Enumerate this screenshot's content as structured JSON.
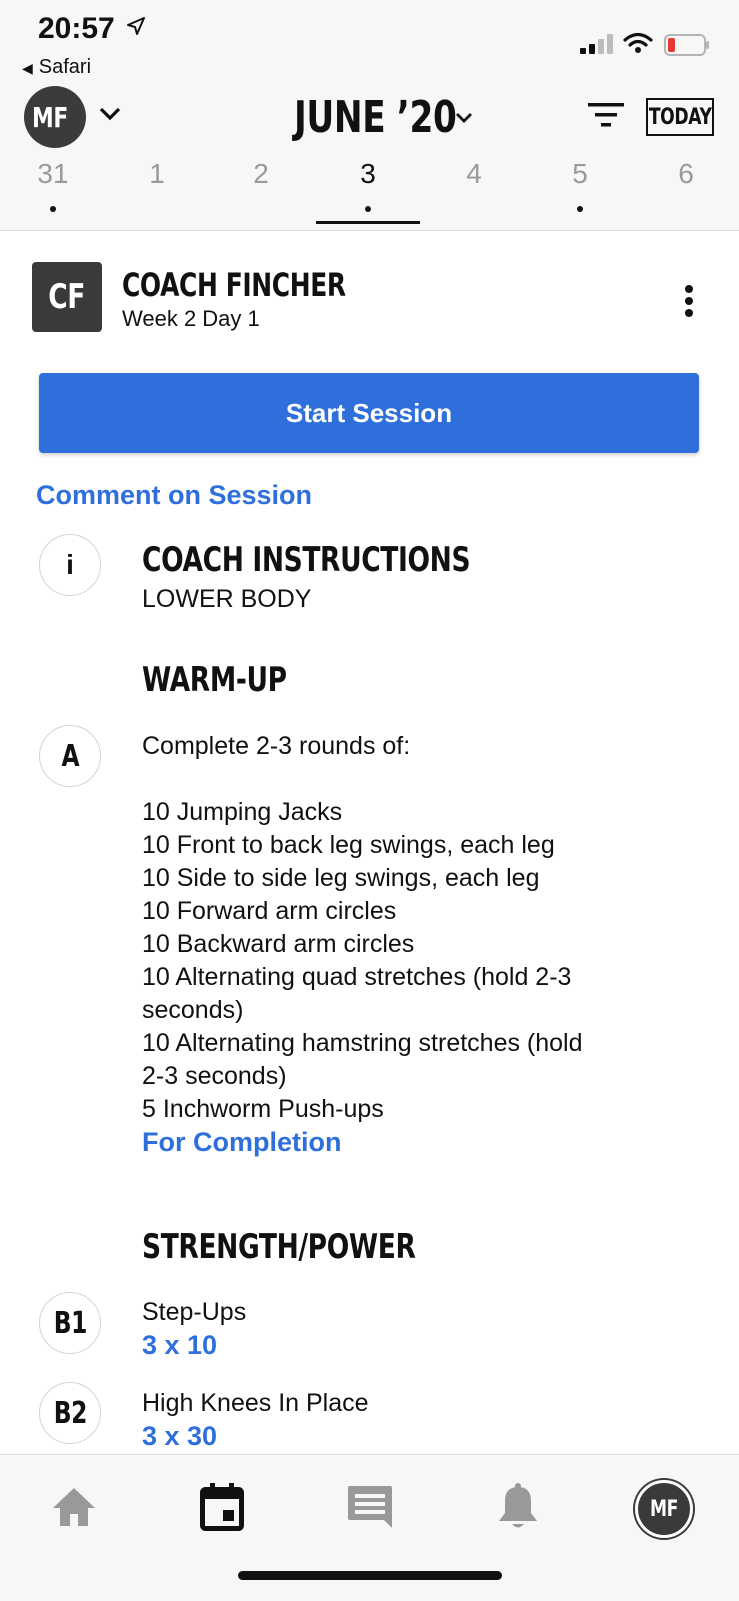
{
  "status_bar": {
    "time": "20:57",
    "back_app": "Safari",
    "location_icon": "location-arrow-icon",
    "signal_icon": "cellular-signal-icon",
    "wifi_icon": "wifi-icon",
    "battery_icon": "battery-low-icon",
    "battery_color": "#e53935"
  },
  "header": {
    "avatar_initials": "MF",
    "month_label": "JUNE ’20",
    "today_label": "TODAY",
    "filter_icon": "filter-icon",
    "days": [
      {
        "label": "31",
        "has_event": true,
        "selected": false
      },
      {
        "label": "1",
        "has_event": false,
        "selected": false
      },
      {
        "label": "2",
        "has_event": false,
        "selected": false
      },
      {
        "label": "3",
        "has_event": true,
        "selected": true
      },
      {
        "label": "4",
        "has_event": false,
        "selected": false
      },
      {
        "label": "5",
        "has_event": true,
        "selected": false
      },
      {
        "label": "6",
        "has_event": false,
        "selected": false
      }
    ]
  },
  "coach": {
    "logo_initials": "CF",
    "name": "COACH FINCHER",
    "subtitle": "Week 2 Day 1"
  },
  "actions": {
    "start_session": "Start Session",
    "comment": "Comment on Session"
  },
  "instructions": {
    "badge": "i",
    "title": "COACH INSTRUCTIONS",
    "text": "LOWER BODY"
  },
  "warmup": {
    "title": "WARM-UP",
    "badge": "A",
    "intro": "Complete 2-3 rounds of:",
    "lines": [
      "10 Jumping Jacks",
      "10 Front to back leg swings, each leg",
      "10 Side to side leg swings, each leg",
      "10 Forward arm circles",
      "10 Backward arm circles",
      "10 Alternating quad stretches (hold 2-3",
      "seconds)",
      "10 Alternating hamstring stretches (hold",
      "2-3 seconds)",
      "5 Inchworm Push-ups"
    ],
    "completion": "For Completion"
  },
  "strength": {
    "title": "STRENGTH/POWER",
    "exercises": [
      {
        "badge": "B1",
        "name": "Step-Ups",
        "sets": "3 x 10"
      },
      {
        "badge": "B2",
        "name": "High Knees In Place",
        "sets": "3 x 30"
      }
    ]
  },
  "tabbar": {
    "tabs": [
      "home-icon",
      "calendar-icon",
      "messages-icon",
      "notifications-icon"
    ],
    "profile_initials": "MF",
    "active_tab": "calendar-icon"
  }
}
